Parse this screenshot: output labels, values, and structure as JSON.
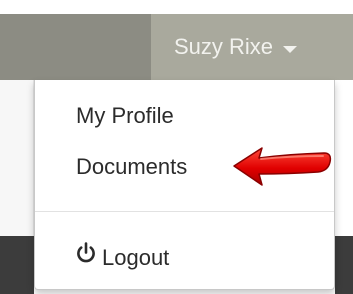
{
  "navbar": {
    "user_name": "Suzy Rixe"
  },
  "dropdown": {
    "items": [
      {
        "label": "My Profile"
      },
      {
        "label": "Documents"
      },
      {
        "label": "Logout",
        "icon": "power-icon"
      }
    ]
  },
  "colors": {
    "navbar_bg": "#8c8c83",
    "user_toggle_bg": "#a9a99d",
    "menu_text": "#2b2b2b",
    "annotation_arrow": "#e00000"
  }
}
